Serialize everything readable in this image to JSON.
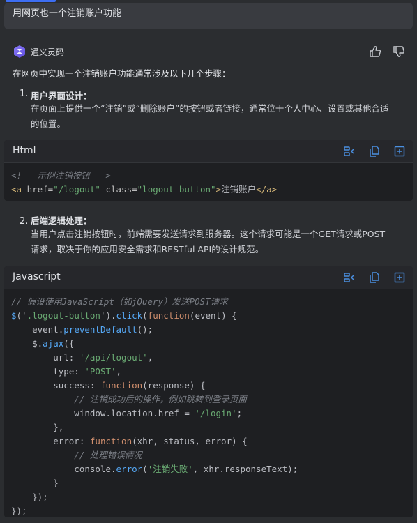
{
  "user_message": "用网页也一个注销账户功能",
  "assistant": {
    "name": "通义灵码",
    "intro": "在网页中实现一个注销账户功能通常涉及以下几个步骤：",
    "steps": [
      {
        "num": "1.",
        "title": "用户界面设计：",
        "lines": [
          "在页面上提供一个“注销”或“删除账户”的按钮或者链接，通常位于个人中心、设置或其他合适",
          "的位置。"
        ]
      },
      {
        "num": "2.",
        "title": "后端逻辑处理：",
        "lines": [
          "当用户点击注销按钮时，前端需要发送请求到服务器。这个请求可能是一个GET请求或POST",
          "请求，取决于你的应用安全需求和RESTful API的设计规范。"
        ]
      }
    ]
  },
  "code_blocks": [
    {
      "lang": "Html",
      "lines": [
        [
          {
            "t": "<!-- 示例注销按钮 -->",
            "c": "comment"
          }
        ],
        [
          {
            "t": "<a ",
            "c": "tag"
          },
          {
            "t": "href=",
            "c": "attr"
          },
          {
            "t": "\"/logout\"",
            "c": "str"
          },
          {
            "t": " class=",
            "c": "attr"
          },
          {
            "t": "\"logout-button\"",
            "c": "str"
          },
          {
            "t": ">",
            "c": "tag"
          },
          {
            "t": "注销账户",
            "c": "plain"
          },
          {
            "t": "</a>",
            "c": "tag"
          }
        ]
      ]
    },
    {
      "lang": "Javascript",
      "lines": [
        [
          {
            "t": "// 假设使用JavaScript（如jQuery）发送POST请求",
            "c": "comment"
          }
        ],
        [
          {
            "t": "$",
            "c": "fn"
          },
          {
            "t": "('",
            "c": "punct"
          },
          {
            "t": ".logout-button",
            "c": "str"
          },
          {
            "t": "').",
            "c": "punct"
          },
          {
            "t": "click",
            "c": "fn"
          },
          {
            "t": "(",
            "c": "punct"
          },
          {
            "t": "function",
            "c": "kw"
          },
          {
            "t": "(event) {",
            "c": "punct"
          }
        ],
        [
          {
            "t": "    event.",
            "c": "plain"
          },
          {
            "t": "preventDefault",
            "c": "fn"
          },
          {
            "t": "();",
            "c": "punct"
          }
        ],
        [
          {
            "t": "    $.",
            "c": "plain"
          },
          {
            "t": "ajax",
            "c": "fn"
          },
          {
            "t": "({",
            "c": "punct"
          }
        ],
        [
          {
            "t": "        url: ",
            "c": "plain"
          },
          {
            "t": "'/api/logout'",
            "c": "str"
          },
          {
            "t": ",",
            "c": "punct"
          }
        ],
        [
          {
            "t": "        type: ",
            "c": "plain"
          },
          {
            "t": "'POST'",
            "c": "str"
          },
          {
            "t": ",",
            "c": "punct"
          }
        ],
        [
          {
            "t": "        success: ",
            "c": "plain"
          },
          {
            "t": "function",
            "c": "kw"
          },
          {
            "t": "(response) {",
            "c": "punct"
          }
        ],
        [
          {
            "t": "            // 注销成功后的操作，例如跳转到登录页面",
            "c": "comment"
          }
        ],
        [
          {
            "t": "            window.location.href = ",
            "c": "plain"
          },
          {
            "t": "'/login'",
            "c": "str"
          },
          {
            "t": ";",
            "c": "punct"
          }
        ],
        [
          {
            "t": "        },",
            "c": "punct"
          }
        ],
        [
          {
            "t": "        error: ",
            "c": "plain"
          },
          {
            "t": "function",
            "c": "kw"
          },
          {
            "t": "(xhr, status, error) {",
            "c": "punct"
          }
        ],
        [
          {
            "t": "            // 处理错误情况",
            "c": "comment"
          }
        ],
        [
          {
            "t": "            console.",
            "c": "plain"
          },
          {
            "t": "error",
            "c": "fn"
          },
          {
            "t": "(",
            "c": "punct"
          },
          {
            "t": "'注销失败'",
            "c": "str"
          },
          {
            "t": ", xhr.responseText);",
            "c": "punct"
          }
        ],
        [
          {
            "t": "        }",
            "c": "punct"
          }
        ],
        [
          {
            "t": "    });",
            "c": "punct"
          }
        ],
        [
          {
            "t": "});",
            "c": "punct"
          }
        ]
      ]
    }
  ],
  "icons": {
    "like": "thumbs-up-icon",
    "dislike": "thumbs-down-icon",
    "insert": "insert-diff-icon",
    "copy": "copy-icon",
    "new_file": "new-file-icon"
  },
  "colors": {
    "accent": "#3d6ef3",
    "code_icon": "#4a8fe0",
    "background": "#2b2d30",
    "code_background": "#1e1f22"
  }
}
